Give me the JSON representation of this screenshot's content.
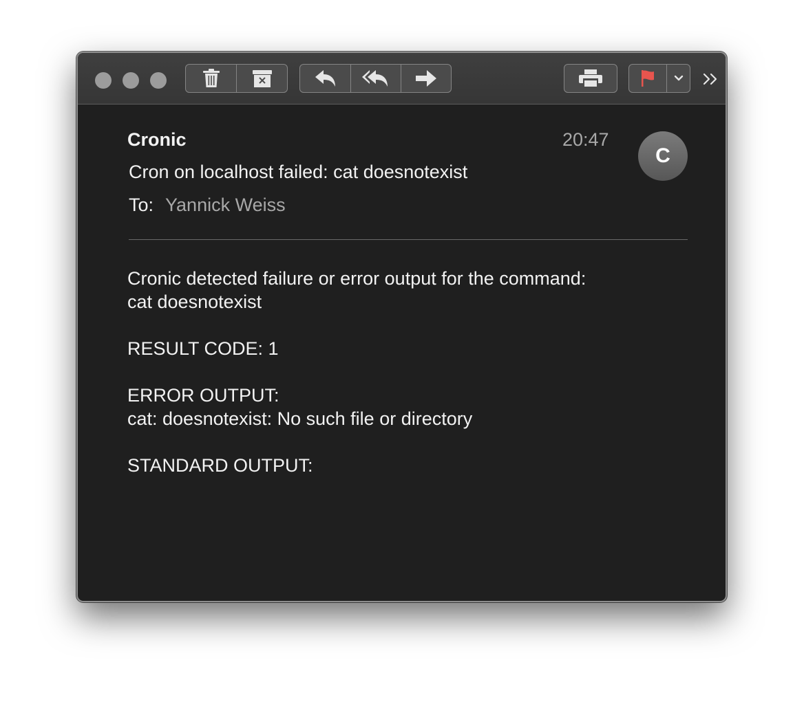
{
  "window": {
    "traffic_lights": [
      "close",
      "minimize",
      "zoom"
    ]
  },
  "toolbar": {
    "groups": [
      {
        "name": "delete-archive",
        "buttons": [
          "trash-icon",
          "archive-icon"
        ]
      },
      {
        "name": "reply-forward",
        "buttons": [
          "reply-icon",
          "reply-all-icon",
          "forward-icon"
        ]
      },
      {
        "name": "print",
        "buttons": [
          "printer-icon"
        ]
      },
      {
        "name": "flag",
        "buttons": [
          "flag-icon",
          "chevron-down-icon"
        ]
      }
    ],
    "flag_color": "#e8554e",
    "overflow_icon": "double-chevron-right-icon"
  },
  "message": {
    "sender": "Cronic",
    "time": "20:47",
    "avatar_initial": "C",
    "subject": "Cron on localhost failed: cat doesnotexist",
    "to_label": "To:",
    "to_name": "Yannick Weiss",
    "body_lines": [
      "Cronic detected failure or error output for the command:",
      "cat doesnotexist",
      "",
      "RESULT CODE: 1",
      "",
      "ERROR OUTPUT:",
      "cat: doesnotexist: No such file or directory",
      "",
      "STANDARD OUTPUT:"
    ]
  },
  "colors": {
    "window_bg": "#1f1f1f",
    "toolbar_bg": "#3b3b3b",
    "text_primary": "#f2f2f2",
    "text_secondary": "#a8a8a8"
  }
}
